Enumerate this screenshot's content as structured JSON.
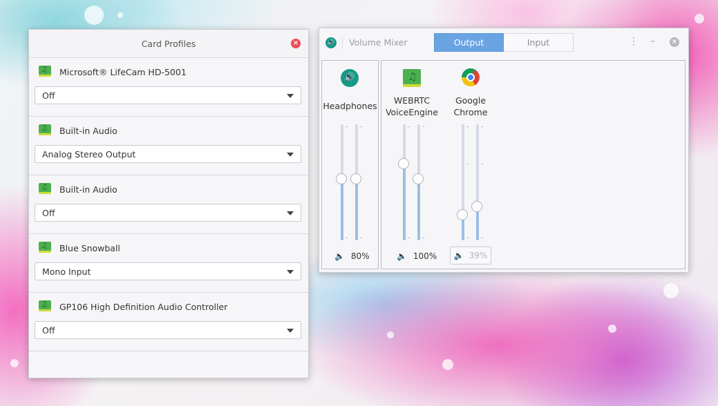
{
  "card_profiles": {
    "title": "Card Profiles",
    "cards": [
      {
        "name": "Microsoft® LifeCam HD-5001",
        "profile": "Off"
      },
      {
        "name": "Built-in Audio",
        "profile": "Analog Stereo Output"
      },
      {
        "name": "Built-in Audio",
        "profile": "Off"
      },
      {
        "name": "Blue Snowball",
        "profile": "Mono Input"
      },
      {
        "name": "GP106 High Definition Audio Controller",
        "profile": "Off"
      }
    ]
  },
  "volume_mixer": {
    "title": "Volume Mixer",
    "tabs": {
      "output": "Output",
      "input": "Input",
      "active": "Output"
    },
    "output_device": {
      "name": "Headphones",
      "volume_label": "80%",
      "left_level": 0.53,
      "right_level": 0.53
    },
    "apps": [
      {
        "name_line1": "WEBRTC",
        "name_line2": "VoiceEngine",
        "volume_label": "100%",
        "muted": false,
        "left_level": 0.66,
        "right_level": 0.53
      },
      {
        "name_line1": "Google",
        "name_line2": "Chrome",
        "volume_label": "39%",
        "muted": true,
        "left_level": 0.22,
        "right_level": 0.29
      }
    ]
  }
}
